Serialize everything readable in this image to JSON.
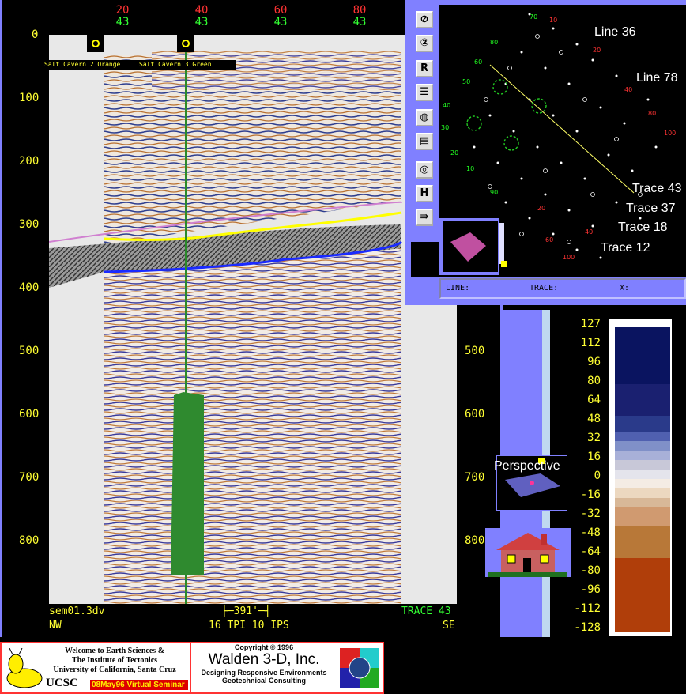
{
  "seismic": {
    "trace_ticks": [
      {
        "red": "20",
        "green": "43"
      },
      {
        "red": "40",
        "green": "43"
      },
      {
        "red": "60",
        "green": "43"
      },
      {
        "red": "80",
        "green": "43"
      }
    ],
    "depth_left": [
      "0",
      "100",
      "200",
      "300",
      "400",
      "500",
      "600",
      "700",
      "800"
    ],
    "depth_right": [
      "500",
      "600",
      "700",
      "800"
    ],
    "well_labels": [
      "Salt Cavern 2 Orange",
      "Salt Cavern 3 Green"
    ],
    "filename": "sem01.3dv",
    "direction_left": "NW",
    "direction_right": "SE",
    "scale": "391'",
    "tpi_ips": "16 TPI 10 IPS",
    "trace_label": "TRACE 43"
  },
  "map": {
    "labels": {
      "line36": "Line 36",
      "line78": "Line 78",
      "trace43": "Trace 43",
      "trace37": "Trace 37",
      "trace18": "Trace 18",
      "trace12": "Trace 12"
    },
    "status": {
      "line": "LINE:",
      "trace": "TRACE:",
      "x": "X:"
    },
    "tools": [
      "select-icon",
      "zoom-icon",
      "R",
      "list-icon",
      "palette-icon",
      "script-icon",
      "ring-icon",
      "H",
      "export-icon"
    ],
    "tool_labels": {
      "r": "R",
      "h": "H"
    }
  },
  "perspective": {
    "label": "Perspective"
  },
  "colorbar": {
    "labels": [
      "127",
      "112",
      "96",
      "80",
      "64",
      "48",
      "32",
      "16",
      "0",
      "-16",
      "-32",
      "-48",
      "-64",
      "-80",
      "-96",
      "-112",
      "-128"
    ]
  },
  "footer": {
    "welcome_line1": "Welcome to Earth Sciences &",
    "welcome_line2": "The Institute of Tectonics",
    "welcome_line3": "University of California, Santa Cruz",
    "ucsc": "UCSC",
    "seminar": "08May96 Virtual Seminar",
    "copyright": "Copyright © 1996",
    "company": "Walden 3-D, Inc.",
    "tagline1": "Designing Responsive Environments",
    "tagline2": "Geotechnical Consulting"
  }
}
